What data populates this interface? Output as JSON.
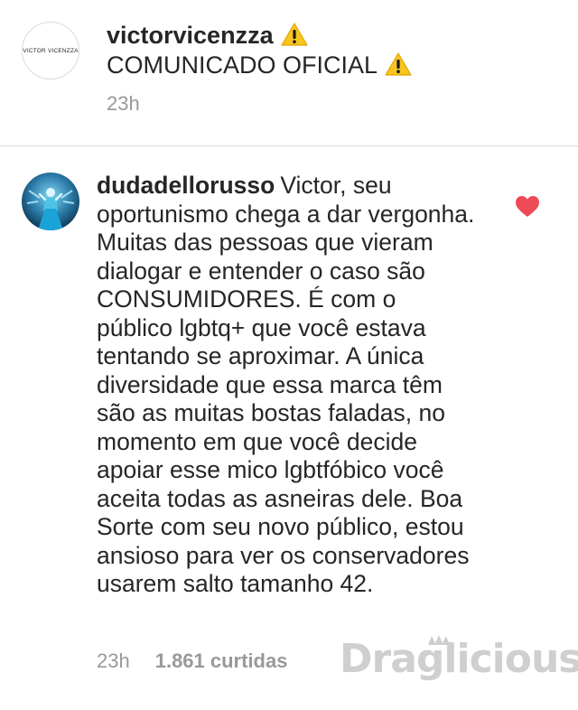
{
  "post": {
    "username": "victorvicenzza",
    "title": "COMUNICADO OFICIAL",
    "time": "23h",
    "avatar_brand": "VICTOR VICENZZA",
    "warning_icon": "warning-icon"
  },
  "comment": {
    "username": "dudadellorusso",
    "text": "Victor, seu oportunismo chega a dar vergonha. Muitas das pessoas que vieram dialogar e entender o caso são CONSUMIDORES. É com o público lgbtq+ que você estava tentando se aproximar. A única diversidade que essa marca têm são as muitas bostas faladas, no momento em que você decide apoiar  esse mico lgbtfóbico você aceita todas as asneiras dele. Boa Sorte com seu novo público, estou ansioso para ver os conservadores usarem salto tamanho 42.",
    "time": "23h",
    "likes": "1.861 curtidas",
    "like_icon": "heart-icon",
    "liked": true
  },
  "watermark": {
    "text": "Draglicious"
  },
  "colors": {
    "text": "#262626",
    "muted": "#999999",
    "heart": "#ed4956",
    "warning": "#f7c51e",
    "divider": "#dbdbdb",
    "watermark": "#cfcfcf"
  }
}
